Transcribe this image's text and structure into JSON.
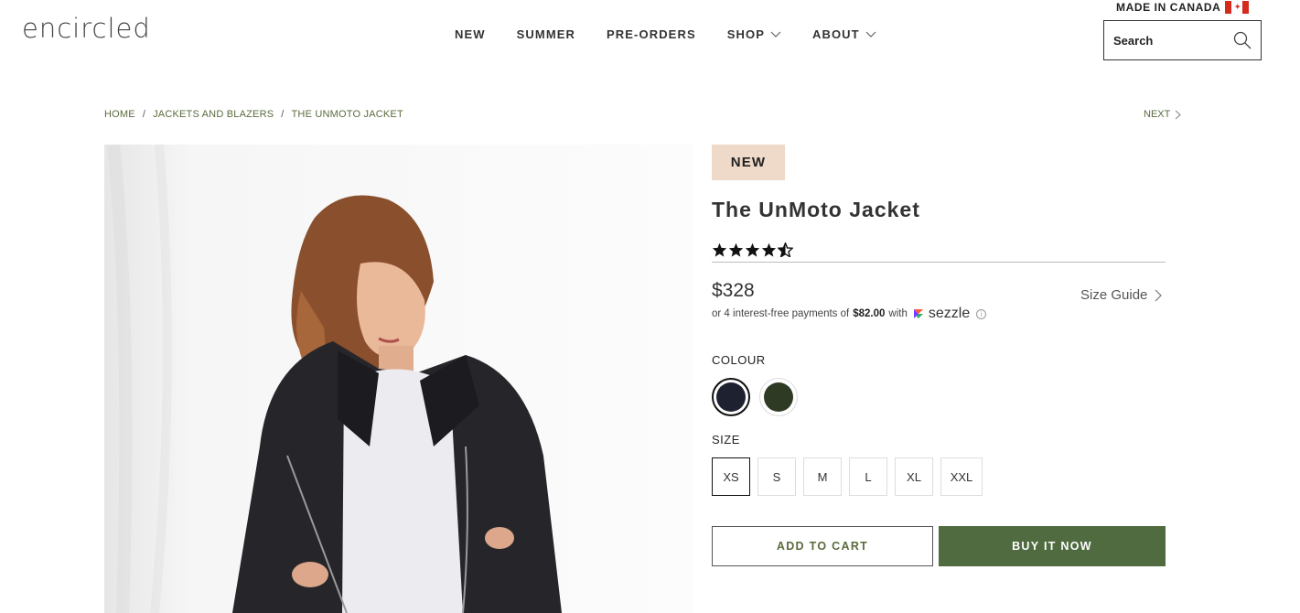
{
  "header": {
    "logo": "encircled",
    "made_in": "MADE IN CANADA",
    "nav": [
      {
        "label": "NEW"
      },
      {
        "label": "SUMMER"
      },
      {
        "label": "PRE-ORDERS"
      },
      {
        "label": "SHOP",
        "dropdown": true
      },
      {
        "label": "ABOUT",
        "dropdown": true
      }
    ],
    "search": {
      "placeholder": "Search"
    }
  },
  "breadcrumb": {
    "items": [
      "HOME",
      "JACKETS AND BLAZERS",
      "THE UNMOTO JACKET"
    ],
    "separator": "/",
    "next": "NEXT"
  },
  "product": {
    "badge": "NEW",
    "title": "The UnMoto Jacket",
    "rating": 4.5,
    "price": "$328",
    "installments": {
      "prefix": "or 4 interest-free payments of",
      "amount": "$82.00",
      "with": "with",
      "provider": "sezzle"
    },
    "size_guide": "Size Guide",
    "colour_label": "COLOUR",
    "colours": [
      {
        "name": "black",
        "hex": "#1e2230",
        "selected": true
      },
      {
        "name": "olive",
        "hex": "#2f3a24",
        "selected": false
      }
    ],
    "size_label": "SIZE",
    "sizes": [
      {
        "label": "XS",
        "selected": true
      },
      {
        "label": "S",
        "selected": false
      },
      {
        "label": "M",
        "selected": false
      },
      {
        "label": "L",
        "selected": false
      },
      {
        "label": "XL",
        "selected": false
      },
      {
        "label": "XXL",
        "selected": false
      }
    ],
    "add_to_cart": "ADD TO CART",
    "buy_now": "BUY IT NOW"
  },
  "colors": {
    "accent_green": "#4f6b3f",
    "badge_bg": "#efd9c9",
    "link_green": "#5a6b3e"
  }
}
